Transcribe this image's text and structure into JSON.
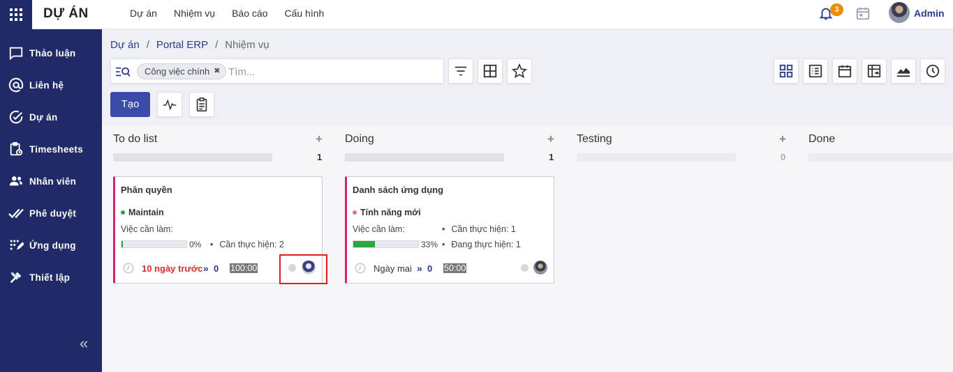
{
  "topbar": {
    "app_title": "DỰ ÁN",
    "menu": [
      "Dự án",
      "Nhiệm vụ",
      "Báo cáo",
      "Cấu hình"
    ],
    "notification_count": "3",
    "user_name": "Admin"
  },
  "sidebar": {
    "items": [
      {
        "label": "Thảo luận",
        "icon": "chat-icon"
      },
      {
        "label": "Liên hệ",
        "icon": "at-icon"
      },
      {
        "label": "Dự án",
        "icon": "check-circle-icon"
      },
      {
        "label": "Timesheets",
        "icon": "clipboard-clock-icon"
      },
      {
        "label": "Nhân viên",
        "icon": "people-icon"
      },
      {
        "label": "Phê duyệt",
        "icon": "double-check-icon"
      },
      {
        "label": "Ứng dụng",
        "icon": "apps-list-icon"
      },
      {
        "label": "Thiết lập",
        "icon": "tools-icon"
      }
    ],
    "collapse_glyph": "«"
  },
  "breadcrumb": {
    "root": "Dự án",
    "project": "Portal ERP",
    "current": "Nhiệm vụ",
    "separator": "/"
  },
  "search": {
    "facet": "Công việc chính",
    "placeholder": "Tìm..."
  },
  "actions": {
    "create_label": "Tạo"
  },
  "columns": [
    {
      "title": "To do list",
      "count": "1",
      "progress": 1.0
    },
    {
      "title": "Doing",
      "count": "1",
      "progress": 1.0
    },
    {
      "title": "Testing",
      "count": "0",
      "progress": 0.0
    },
    {
      "title": "Done",
      "count": "",
      "progress": 0.0
    }
  ],
  "cards": [
    {
      "title": "Phân quyền",
      "tag": "Maintain",
      "tag_color": "#28a745",
      "todo_label": "Việc cần làm:",
      "progress": 0.02,
      "progress_text": "0%",
      "stats": [
        "Cần thực hiện: 2"
      ],
      "deadline": "10 ngày trước",
      "deadline_color": "#d32f2f",
      "subtasks": "0",
      "hours": "100:00"
    },
    {
      "title": "Danh sách ứng dụng",
      "tag": "Tính năng mới",
      "tag_color": "#e57373",
      "todo_label": "Việc cần làm:",
      "progress": 0.33,
      "progress_text": "33%",
      "stats": [
        "Cần thực hiện: 1",
        "Đang thực hiện: 1"
      ],
      "deadline": "Ngày mai",
      "deadline_color": "#333333",
      "subtasks": "0",
      "hours": "50:00"
    }
  ],
  "colors": {
    "sidebar_bg": "#1f2a66",
    "primary": "#3a4aa8",
    "accent_link": "#2c3b8e",
    "badge": "#f08a00",
    "card_border_left": "#d6226d",
    "highlight": "#e21b1b"
  }
}
